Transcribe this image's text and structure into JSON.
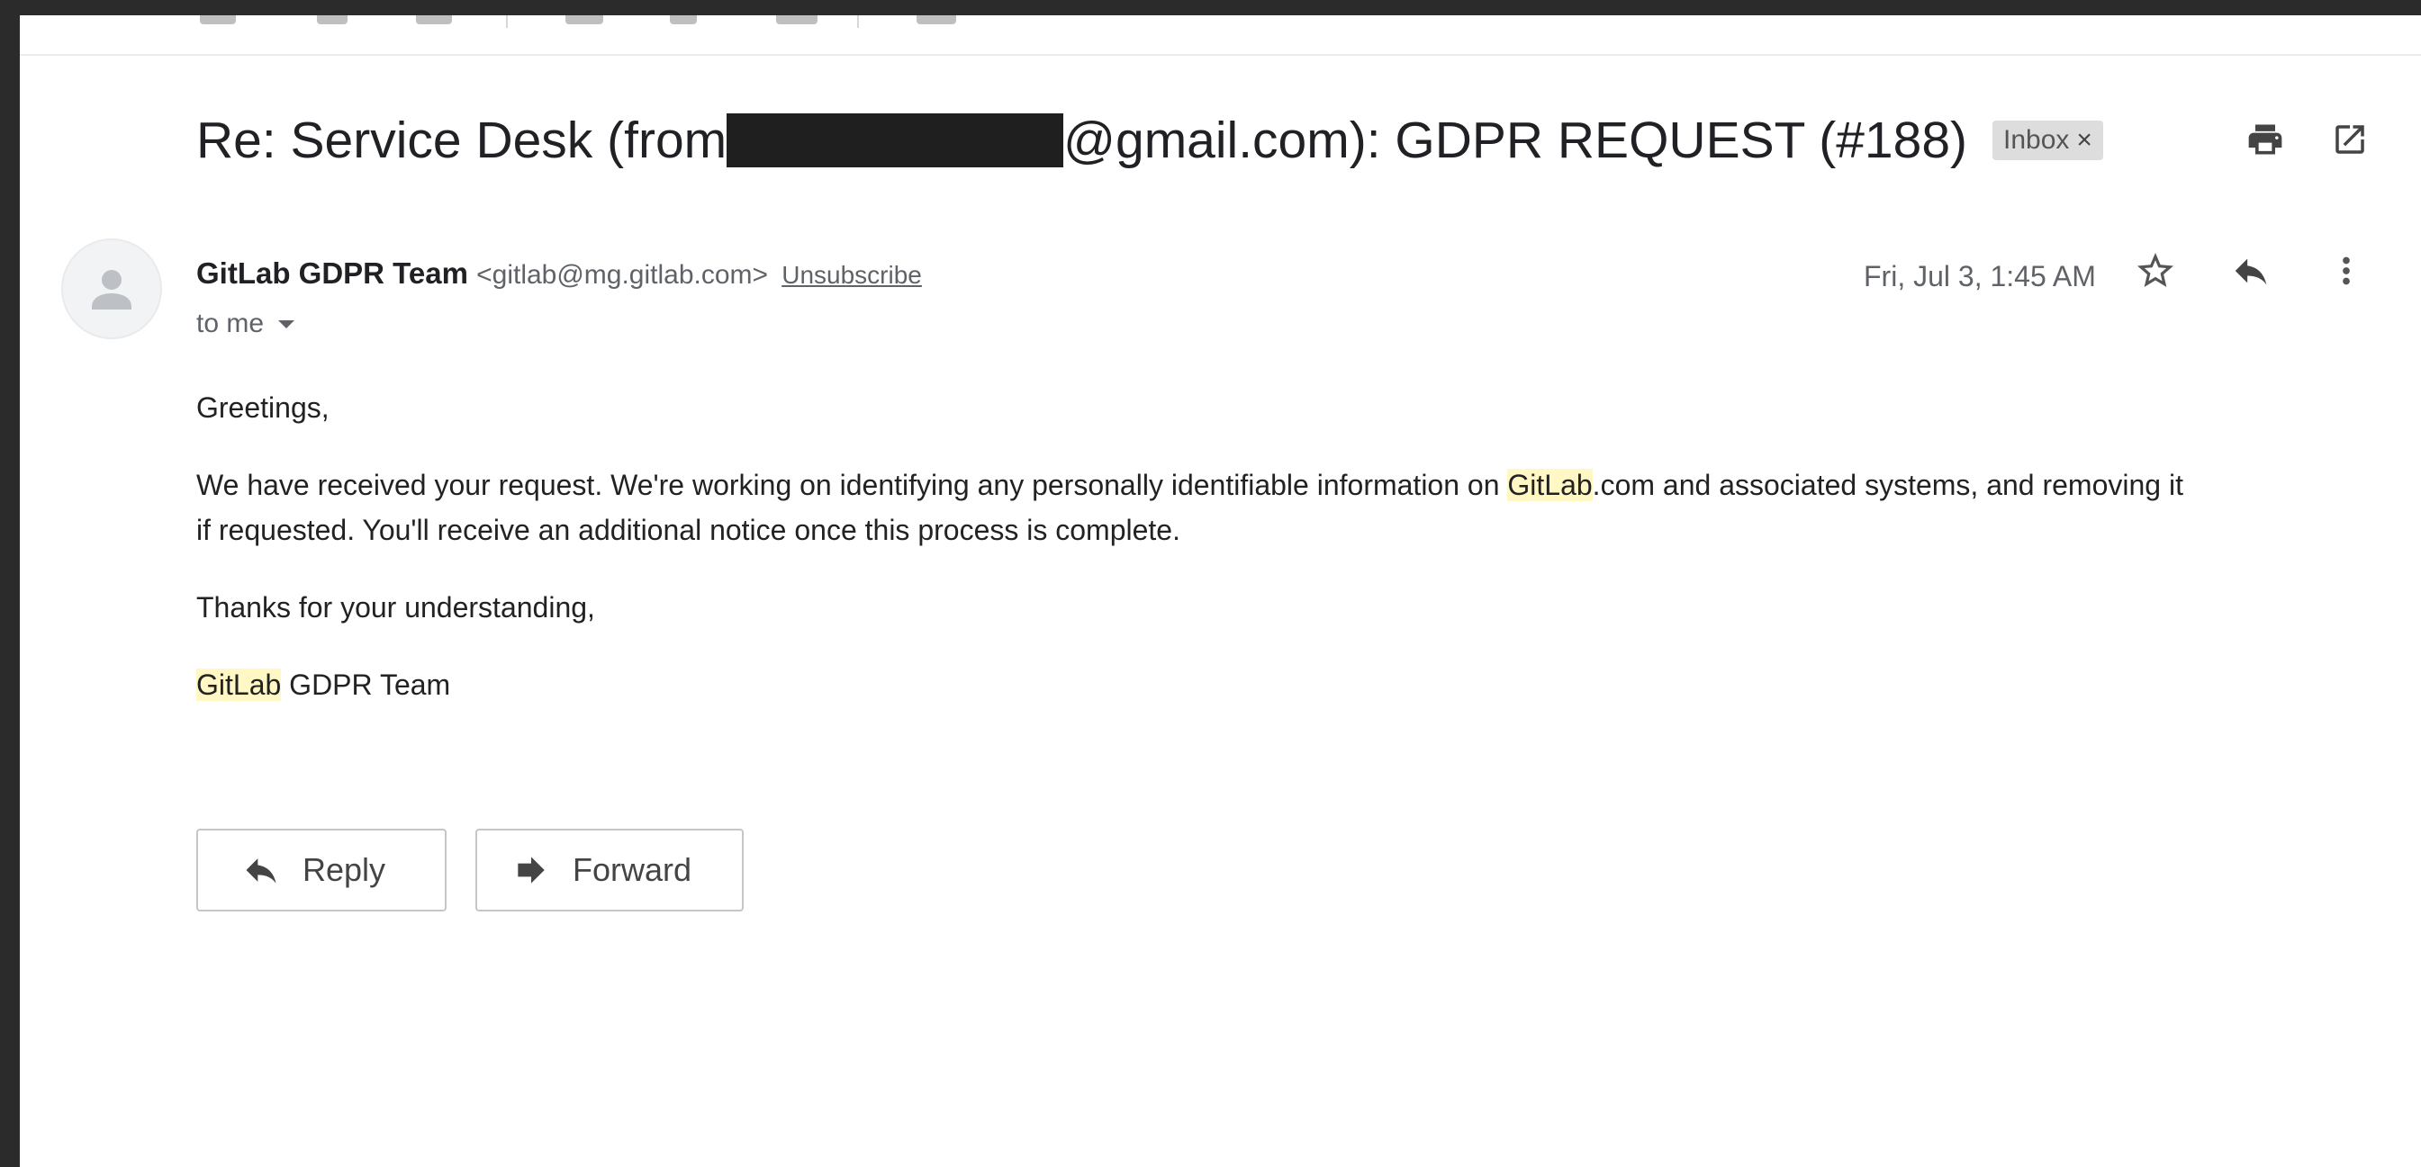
{
  "email": {
    "subject_prefix": "Re: Service Desk (from ",
    "subject_suffix": "@gmail.com): GDPR REQUEST (#188)",
    "label_chip": "Inbox",
    "label_chip_close": "×",
    "sender_name": "GitLab GDPR Team",
    "sender_email": "<gitlab@mg.gitlab.com>",
    "unsubscribe_label": "Unsubscribe",
    "recipient_label": "to me",
    "date": "Fri, Jul 3, 1:45 AM",
    "body": {
      "greeting": "Greetings,",
      "para1_a": "We have received your request. We're working on identifying any personally identifiable information on ",
      "para1_hl": "GitLab",
      "para1_b": ".com and associated systems, and removing it",
      "para2": "if requested. You'll receive an additional notice once this process is complete.",
      "thanks": "Thanks for your understanding,",
      "sig_hl": "GitLab",
      "sig_rest": " GDPR Team"
    }
  },
  "actions": {
    "reply_label": "Reply",
    "forward_label": "Forward"
  },
  "icons": {
    "print": "print-icon",
    "open_new_window": "open-in-new-window-icon",
    "star": "star-icon",
    "reply": "reply-icon",
    "more": "more-vertical-icon",
    "avatar": "person-icon",
    "forward": "forward-icon"
  },
  "colors": {
    "highlight": "#fff7c4",
    "redaction": "#1f1f1f",
    "chip_bg": "#dddddd"
  }
}
